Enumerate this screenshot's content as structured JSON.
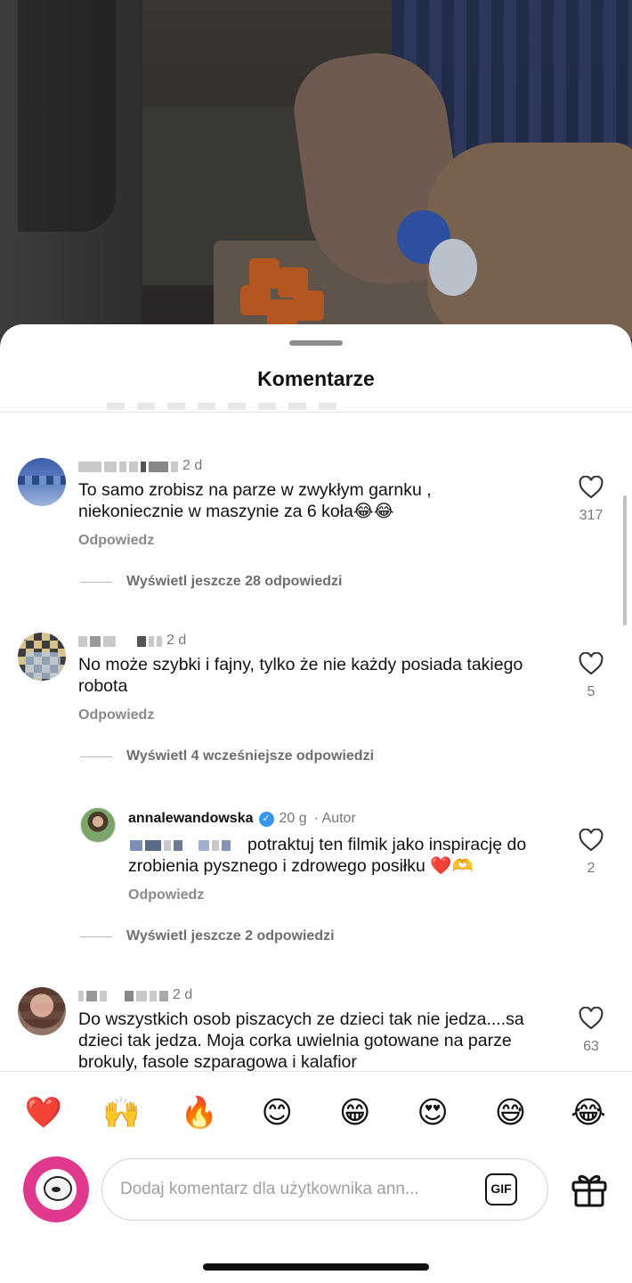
{
  "sheet": {
    "title": "Komentarze"
  },
  "comments": [
    {
      "time": "2 d",
      "text": "To samo zrobisz na parze w zwykłym garnku , niekoniecznie w maszynie za 6 koła😂😂",
      "reply_label": "Odpowiedz",
      "likes": "317",
      "more_replies": "Wyświetl jeszcze 28 odpowiedzi"
    },
    {
      "time": "2 d",
      "text": "No może szybki i fajny, tylko że nie każdy posiada takiego robota",
      "reply_label": "Odpowiedz",
      "likes": "5",
      "earlier_replies": "Wyświetl 4 wcześniejsze odpowiedzi",
      "reply": {
        "username": "annalewandowska",
        "verified_icon": "✓",
        "time": "20 g",
        "author_tag": "· Autor",
        "text": "potraktuj ten filmik jako inspirację do zrobienia pysznego i zdrowego posiłku ❤️🫶",
        "reply_label": "Odpowiedz",
        "likes": "2"
      },
      "more_replies": "Wyświetl jeszcze 2 odpowiedzi"
    },
    {
      "time": "2 d",
      "text": "Do wszystkich osob piszacych ze dzieci tak nie jedza....sa dzieci tak jedza. Moja corka uwielnia gotowane na parze brokuly, fasole szparagowa i kalafior",
      "likes": "63"
    }
  ],
  "emoji_bar": [
    "❤️",
    "🙌",
    "🔥",
    "😊",
    "😁",
    "😍",
    "😅",
    "😂"
  ],
  "composer": {
    "placeholder": "Dodaj komentarz dla użytkownika ann...",
    "gif_label": "GIF"
  },
  "colors": {
    "accent_avatar": "#e0398d",
    "verified": "#3797f0",
    "heart": "#ed1c3b"
  },
  "icons": {
    "like": "heart-outline-icon",
    "gift": "gift-icon"
  }
}
